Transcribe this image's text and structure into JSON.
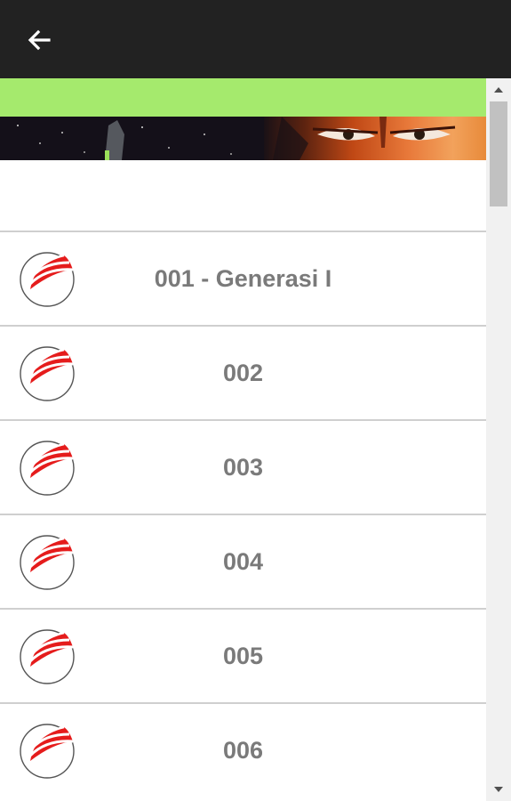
{
  "app_bar": {
    "back_icon": "arrow-left-icon",
    "background": "#222222"
  },
  "green_bar_color": "#a5ea6d",
  "banner": {
    "description_colors": [
      "#141019",
      "#e8793a"
    ]
  },
  "items": [
    {
      "label": "001 - Generasi I",
      "icon": "chapter-logo-icon"
    },
    {
      "label": "002",
      "icon": "chapter-logo-icon"
    },
    {
      "label": "003",
      "icon": "chapter-logo-icon"
    },
    {
      "label": "004",
      "icon": "chapter-logo-icon"
    },
    {
      "label": "005",
      "icon": "chapter-logo-icon"
    },
    {
      "label": "006",
      "icon": "chapter-logo-icon"
    }
  ],
  "accent_color": "#e51c1c"
}
